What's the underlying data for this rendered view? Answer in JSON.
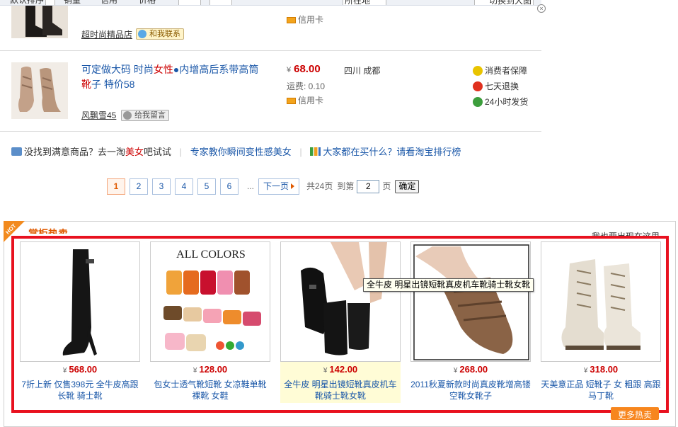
{
  "filterbar": {
    "sort": "默认排序",
    "sales": "销量",
    "credit": "信用",
    "price": "价格",
    "location": "所在地",
    "switch": "切换到大图"
  },
  "prev_row": {
    "seller": "超时尚精品店",
    "contact": "和我联系",
    "payment": "信用卡"
  },
  "row": {
    "title_parts": [
      "可定做大码 时尚",
      "女性",
      "●内增高后系带高筒",
      "靴",
      "子 特价58"
    ],
    "currency": "¥",
    "price": "68.00",
    "shipping": "运费: 0.10",
    "payment": "信用卡",
    "location": "四川 成都",
    "seller": "风飘雪45",
    "message": "给我留言",
    "services": [
      "消费者保障",
      "七天退换",
      "24小时发货"
    ]
  },
  "colors": {
    "accent_red": "#c00000",
    "link_blue": "#1a57a8",
    "hot_orange": "#e05a00",
    "frame_red": "#e8111f"
  },
  "tips": {
    "t1_pre": "没找到满意商品？去一淘",
    "t1_red": "美女",
    "t1_post": "吧试试",
    "t2": "专家教你瞬间变性感美女",
    "t3": "大家都在买什么？请看淘宝排行榜"
  },
  "pager": {
    "pages": [
      "1",
      "2",
      "3",
      "4",
      "5",
      "6"
    ],
    "current": "1",
    "dots": "...",
    "next": "下一页",
    "total": "共24页",
    "goto_label": "到第",
    "goto_value": "2",
    "page_unit": "页",
    "confirm": "确定"
  },
  "hot": {
    "tag": "HOT",
    "title": "掌柜热卖",
    "link": "我也要出现在这里",
    "more": "更多热卖",
    "items": [
      {
        "currency": "¥",
        "price": "568.00",
        "title": "7折上新 仅售398元 全牛皮高跟长靴 骑士靴"
      },
      {
        "currency": "¥",
        "price": "128.00",
        "title": "包女士透气靴短靴 女凉鞋单靴裸靴 女鞋",
        "img_text": "ALL COLORS"
      },
      {
        "currency": "¥",
        "price": "142.00",
        "title": "全牛皮 明星出镜短靴真皮机车靴骑士靴女靴"
      },
      {
        "currency": "¥",
        "price": "268.00",
        "title": "2011秋夏新款时尚真皮靴增高镂空靴女靴子"
      },
      {
        "currency": "¥",
        "price": "318.00",
        "title": "天美意正品 短靴子 女 粗跟 高跟 马丁靴"
      }
    ]
  },
  "tooltip": "全牛皮 明星出镜短靴真皮机车靴骑士靴女靴"
}
